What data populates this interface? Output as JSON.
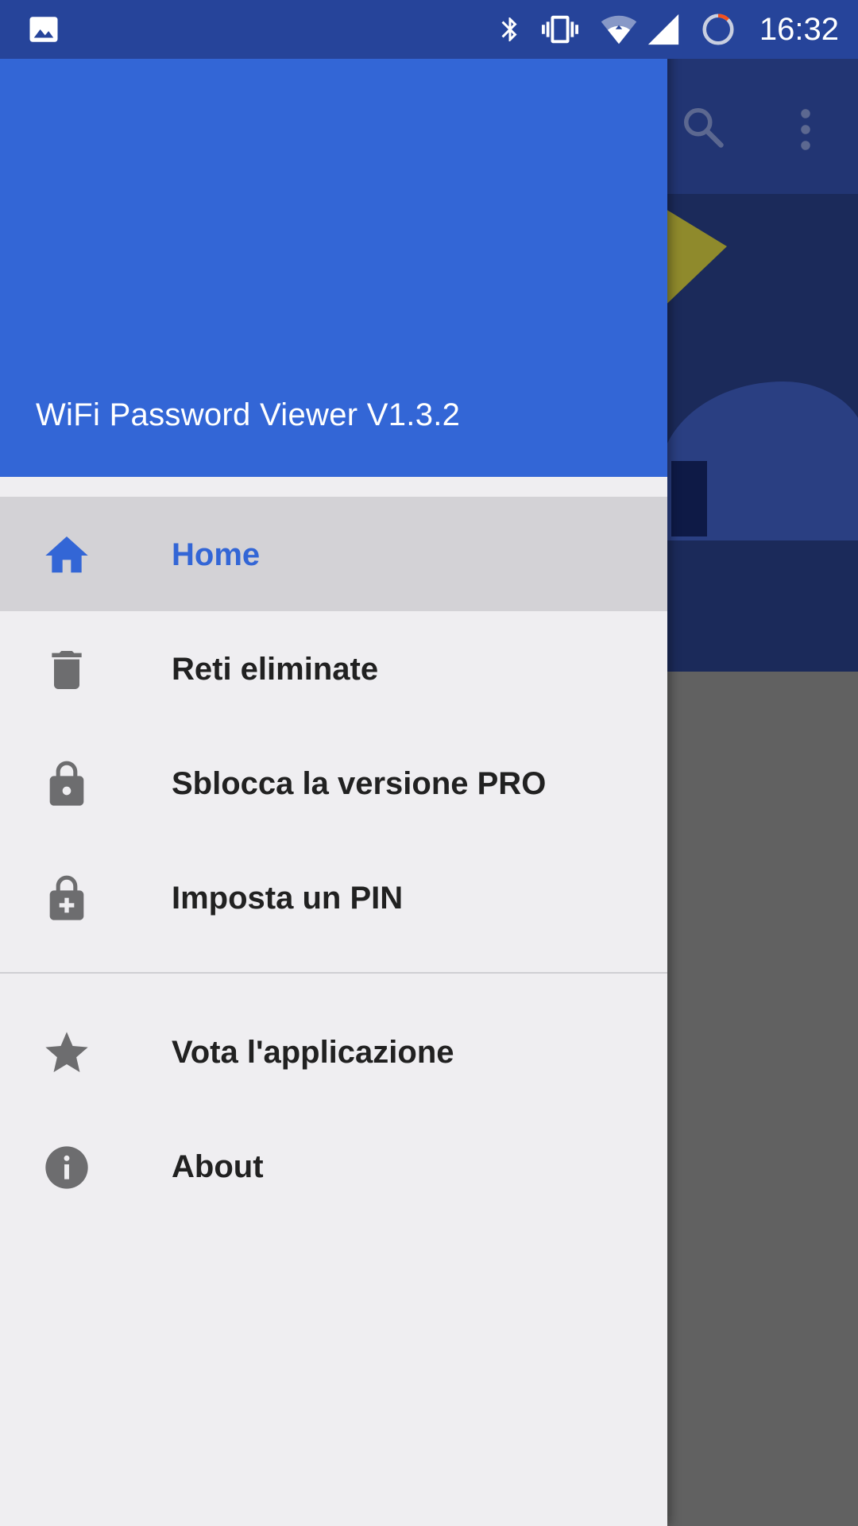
{
  "status_bar": {
    "time": "16:32",
    "icons": [
      "image-icon",
      "bluetooth-icon",
      "vibrate-icon",
      "wifi-icon",
      "cell-signal-icon",
      "sync-icon"
    ]
  },
  "background_toolbar": {
    "icons": [
      "search-icon",
      "overflow-menu-icon"
    ]
  },
  "drawer": {
    "title": "WiFi Password Viewer V1.3.2",
    "header_color": "#3366d6",
    "items": [
      {
        "label": "Home",
        "icon": "home-icon",
        "active": true
      },
      {
        "label": "Reti eliminate",
        "icon": "trash-icon",
        "active": false
      },
      {
        "label": "Sblocca la versione PRO",
        "icon": "lock-icon",
        "active": false
      },
      {
        "label": "Imposta un PIN",
        "icon": "lock-plus-icon",
        "active": false
      },
      {
        "label": "Vota l'applicazione",
        "icon": "star-icon",
        "active": false
      },
      {
        "label": "About",
        "icon": "info-icon",
        "active": false
      }
    ]
  },
  "colors": {
    "accent": "#3366d6",
    "status_bar": "#26449a",
    "drawer_background": "#efeef1",
    "active_item_background": "#d3d2d6",
    "icon_grey": "#6d6d6f"
  }
}
